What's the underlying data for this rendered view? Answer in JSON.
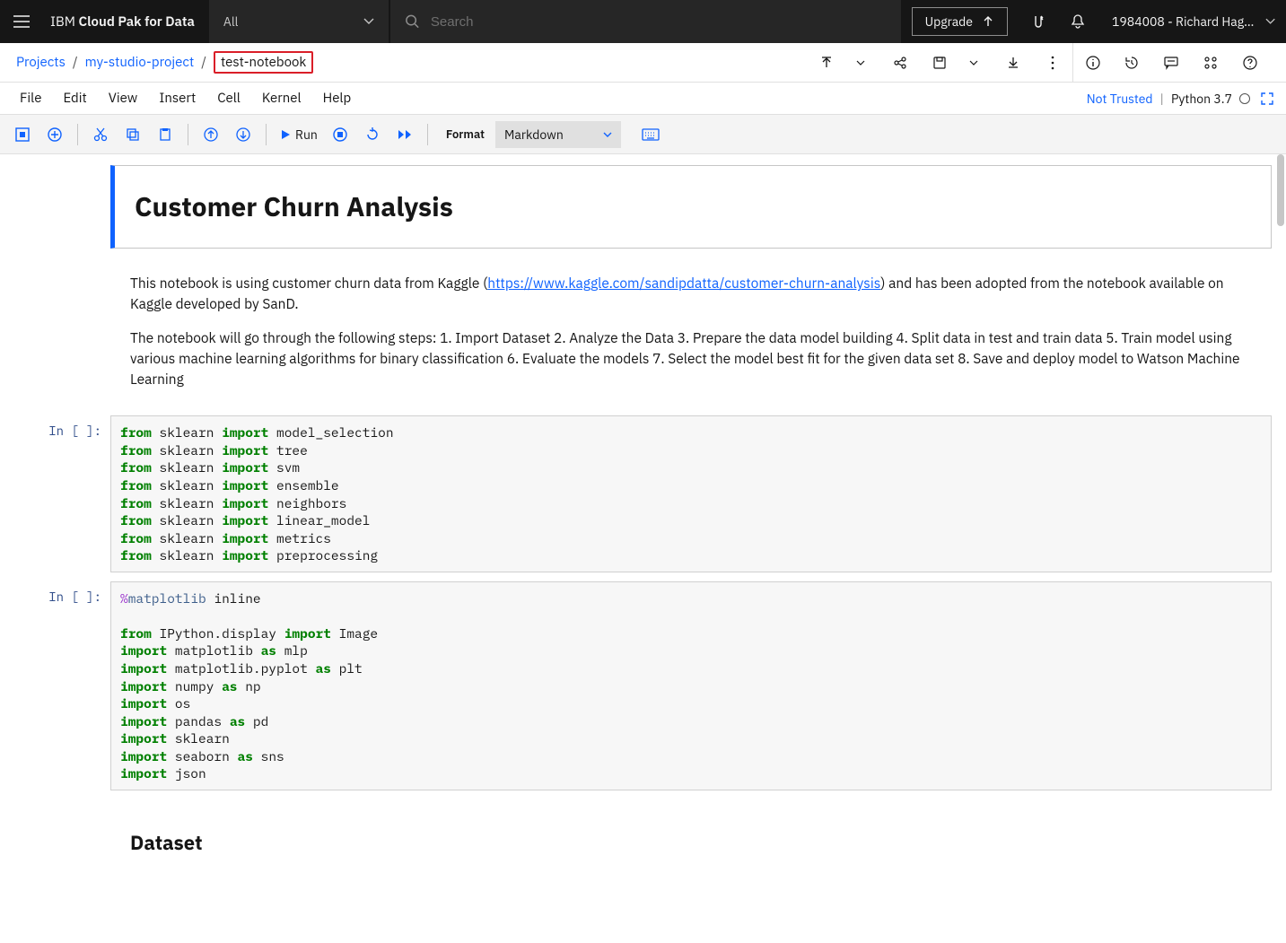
{
  "topbar": {
    "brand_prefix": "IBM ",
    "brand_bold": "Cloud Pak for Data",
    "dropdown": "All",
    "search_placeholder": "Search",
    "upgrade": "Upgrade",
    "user": "1984008 - Richard Hagart..."
  },
  "breadcrumb": {
    "root": "Projects",
    "project": "my-studio-project",
    "current": "test-notebook"
  },
  "menu": {
    "items": [
      "File",
      "Edit",
      "View",
      "Insert",
      "Cell",
      "Kernel",
      "Help"
    ],
    "trust": "Not Trusted",
    "kernel": "Python 3.7"
  },
  "toolbar": {
    "run": "Run",
    "format_label": "Format",
    "format_value": "Markdown"
  },
  "notebook": {
    "title": "Customer Churn Analysis",
    "intro_pre": "This notebook is using customer churn data from Kaggle (",
    "intro_link": "https://www.kaggle.com/sandipdatta/customer-churn-analysis",
    "intro_post": ") and has been adopted from the notebook available on Kaggle developed by SanD.",
    "steps": "The notebook will go through the following steps: 1. Import Dataset 2. Analyze the Data 3. Prepare the data model building 4. Split data in test and train data 5. Train model using various machine learning algorithms for binary classification 6. Evaluate the models 7. Select the model best fit for the given data set 8. Save and deploy model to Watson Machine Learning",
    "prompt": "In [ ]:",
    "code1_modules": [
      "model_selection",
      "tree",
      "svm",
      "ensemble",
      "neighbors",
      "linear_model",
      "metrics",
      "preprocessing"
    ],
    "code2_magic": "%matplotlib inline",
    "dataset_heading": "Dataset"
  }
}
